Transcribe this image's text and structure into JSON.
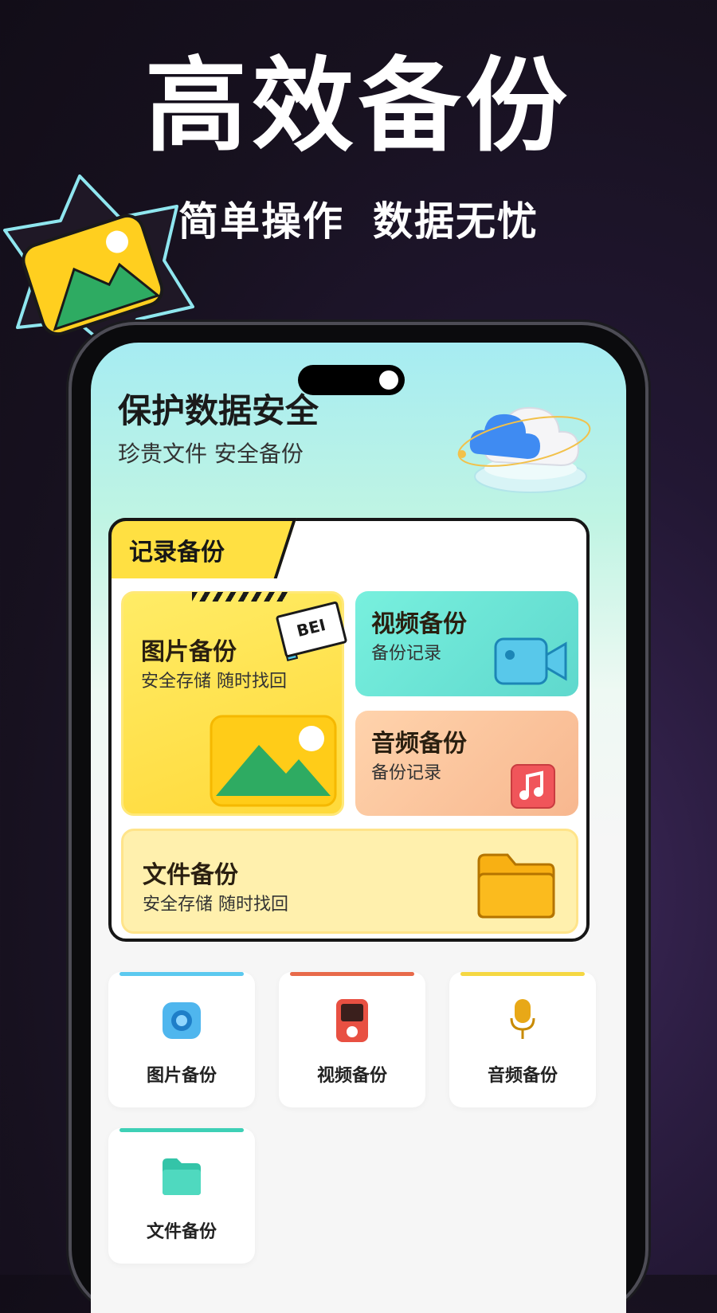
{
  "promo": {
    "headline": "高效备份",
    "tagline_left": "简单操作",
    "tagline_right": "数据无忧"
  },
  "app": {
    "hero_title": "保护数据安全",
    "hero_subtitle": "珍贵文件 安全备份",
    "section_tab": "记录备份",
    "cards": {
      "photo": {
        "title": "图片备份",
        "subtitle": "安全存储 随时找回",
        "flag_text": "BEI"
      },
      "video": {
        "title": "视频备份",
        "subtitle": "备份记录"
      },
      "audio": {
        "title": "音频备份",
        "subtitle": "备份记录"
      },
      "file": {
        "title": "文件备份",
        "subtitle": "安全存储 随时找回"
      }
    },
    "tiles": [
      {
        "label": "图片备份",
        "icon": "camera-icon",
        "color": "#5cc9ef"
      },
      {
        "label": "视频备份",
        "icon": "video-player-icon",
        "color": "#e86a4a"
      },
      {
        "label": "音频备份",
        "icon": "microphone-icon",
        "color": "#f5c542"
      },
      {
        "label": "文件备份",
        "icon": "folder-icon",
        "color": "#3ed0b6"
      }
    ]
  }
}
